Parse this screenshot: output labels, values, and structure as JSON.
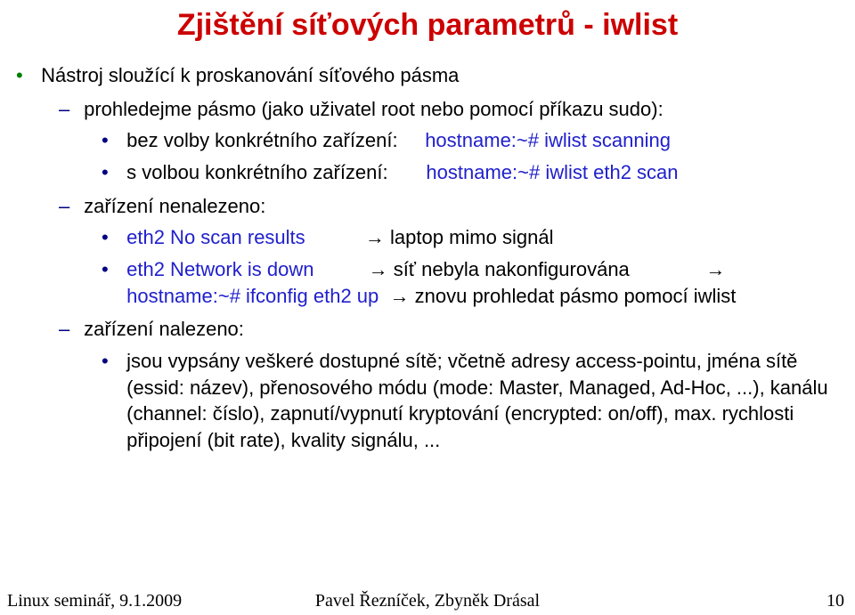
{
  "title": "Zjištění síťových parametrů - iwlist",
  "bullet1": "Nástroj sloužící k proskanování síťového pásma",
  "sub1": "prohledejme pásmo (jako uživatel root nebo pomocí příkazu sudo):",
  "s1a_label": "bez volby konkrétního zařízení:",
  "s1a_cmd": "hostname:~# iwlist scanning",
  "s1b_label": "s volbou konkrétního zařízení:",
  "s1b_cmd": "hostname:~# iwlist eth2 scan",
  "sub2": "zařízení nenalezeno:",
  "s2a_cmd": "eth2   No scan results",
  "s2a_arrow": "→ laptop mimo signál",
  "s2b_cmd1": "eth2   Network is down",
  "s2b_arrow1": "→ síť nebyla nakonfigurována",
  "s2b_arrow1_tail": "→",
  "s2b_cmd2": "hostname:~# ifconfig eth2 up",
  "s2b_arrow2": "→ znovu prohledat pásmo pomocí iwlist",
  "sub3": "zařízení nalezeno:",
  "s3a": "jsou vypsány veškeré dostupné sítě; včetně adresy access-pointu, jména sítě (essid: název), přenosového módu (mode: Master, Managed, Ad-Hoc, ...), kanálu (channel: číslo), zapnutí/vypnutí kryptování (encrypted: on/off), max. rychlosti připojení (bit rate), kvality signálu, ...",
  "footer_left": "Linux seminář, 9.1.2009",
  "footer_center": "Pavel Řezníček, Zbyněk Drásal",
  "footer_right": "10"
}
